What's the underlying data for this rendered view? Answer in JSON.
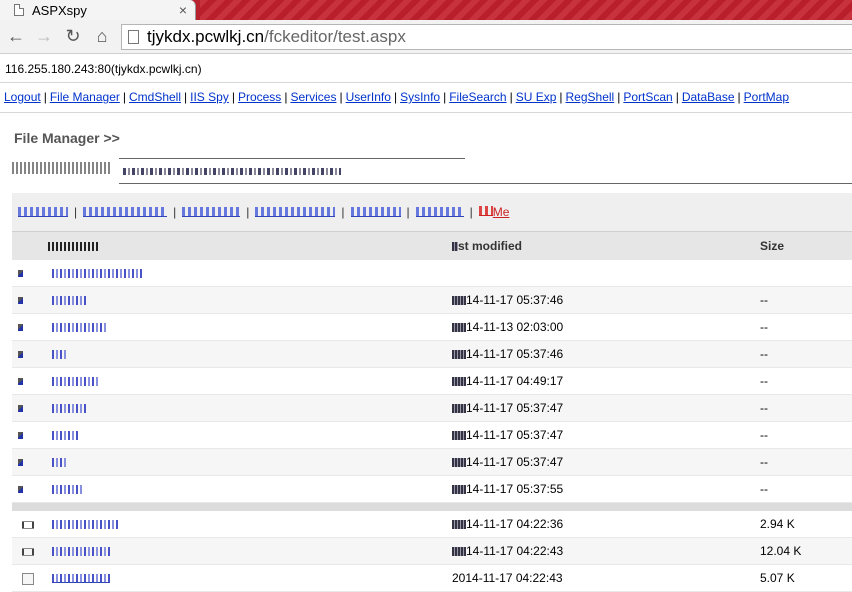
{
  "browser": {
    "tab_title": "ASPXspy",
    "tab_close": "×",
    "url_host": "tjykdx.pcwlkj.cn",
    "url_path": "/fckeditor/test.aspx"
  },
  "page": {
    "host_line": "116.255.180.243:80(tjykdx.pcwlkj.cn)",
    "menu": [
      "Logout",
      "File Manager",
      "CmdShell",
      "IIS Spy",
      "Process",
      "Services",
      "UserInfo",
      "SysInfo",
      "FileSearch",
      "SU Exp",
      "RegShell",
      "PortScan",
      "DataBase",
      "PortMap"
    ],
    "section_title": "File Manager >>",
    "actions_tail": "Me"
  },
  "table": {
    "headers": {
      "modified": "st modified",
      "size": "Size"
    },
    "dir_rows": [
      {
        "modified": "",
        "size": ""
      },
      {
        "modified": "14-11-17 05:37:46",
        "size": "--"
      },
      {
        "modified": "14-11-13 02:03:00",
        "size": "--"
      },
      {
        "modified": "14-11-17 05:37:46",
        "size": "--"
      },
      {
        "modified": "14-11-17 04:49:17",
        "size": "--"
      },
      {
        "modified": "14-11-17 05:37:47",
        "size": "--"
      },
      {
        "modified": "14-11-17 05:37:47",
        "size": "--"
      },
      {
        "modified": "14-11-17 05:37:47",
        "size": "--"
      },
      {
        "modified": "14-11-17 05:37:55",
        "size": "--"
      }
    ],
    "file_rows": [
      {
        "modified": "14-11-17 04:22:36",
        "size": "2.94 K"
      },
      {
        "modified": "14-11-17 04:22:43",
        "size": "12.04 K"
      },
      {
        "modified": "2014-11-17 04:22:43",
        "size": "5.07 K"
      }
    ]
  }
}
